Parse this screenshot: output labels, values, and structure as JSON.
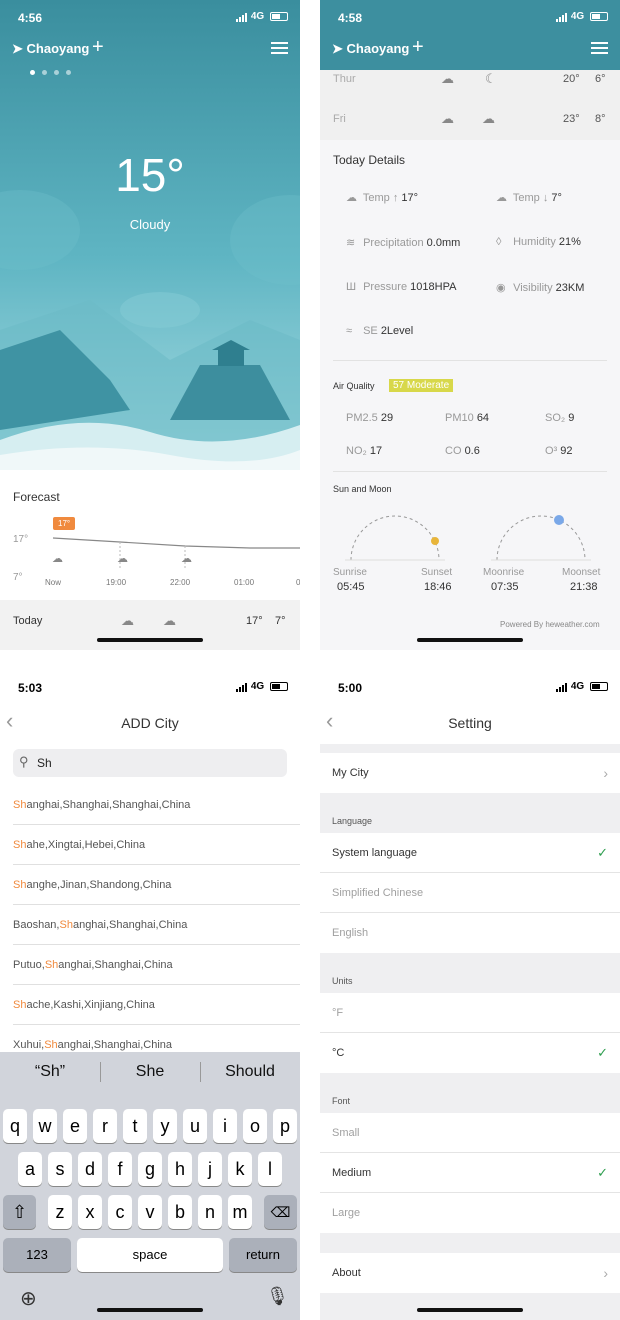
{
  "colors": {
    "teal_top": "#3b8f9f",
    "teal_mid": "#5db3c2",
    "accent_orange": "#f08a3e",
    "aqi_yellow": "#d8d84a",
    "check_green": "#2e9e4f",
    "search_hl": "#f08a3e"
  },
  "p1": {
    "status": {
      "time": "4:56",
      "network": "4G"
    },
    "city": "Chaoyang",
    "plus": "+",
    "temp": "15°",
    "condition": "Cloudy",
    "forecast_title": "Forecast",
    "high_tag": "17°",
    "axis_high": "17°",
    "axis_low": "7°",
    "times": [
      "Now",
      "19:00",
      "22:00",
      "01:00",
      "0"
    ],
    "today_label": "Today",
    "today_high": "17°",
    "today_low": "7°"
  },
  "p2": {
    "status": {
      "time": "4:58",
      "network": "4G"
    },
    "city": "Chaoyang",
    "plus": "+",
    "days": [
      {
        "day": "Thur",
        "hi": "20°",
        "lo": "6°"
      },
      {
        "day": "Fri",
        "hi": "23°",
        "lo": "8°"
      }
    ],
    "details_title": "Today Details",
    "details": {
      "temp_hi_label": "Temp ↑",
      "temp_hi": "17°",
      "temp_lo_label": "Temp ↓",
      "temp_lo": "7°",
      "precip_label": "Precipitation",
      "precip": "0.0mm",
      "humidity_label": "Humidity",
      "humidity": "21%",
      "pressure_label": "Pressure",
      "pressure": "1018HPA",
      "visibility_label": "Visibility",
      "visibility": "23KM",
      "wind_dir": "SE",
      "wind_level": "2Level"
    },
    "aq_label": "Air Quality",
    "aq_badge": "57 Moderate",
    "aq": {
      "pm25_label": "PM2.5",
      "pm25": "29",
      "pm10_label": "PM10",
      "pm10": "64",
      "so2_label": "SO₂",
      "so2": "9",
      "no2_label": "NO₂",
      "no2": "17",
      "co_label": "CO",
      "co": "0.6",
      "o3_label": "O³",
      "o3": "92"
    },
    "sun_title": "Sun and Moon",
    "sunrise_label": "Sunrise",
    "sunrise": "05:45",
    "sunset_label": "Sunset",
    "sunset": "18:46",
    "moonrise_label": "Moonrise",
    "moonrise": "07:35",
    "moonset_label": "Moonset",
    "moonset": "21:38",
    "powered": "Powered By heweather.com"
  },
  "p3": {
    "status": {
      "time": "5:03",
      "network": "4G"
    },
    "title": "ADD City",
    "search_value": "Sh",
    "results": [
      {
        "pre": "",
        "hl": "Sh",
        "post": "anghai,Shanghai,Shanghai,China"
      },
      {
        "pre": "",
        "hl": "Sh",
        "post": "ahe,Xingtai,Hebei,China"
      },
      {
        "pre": "",
        "hl": "Sh",
        "post": "anghe,Jinan,Shandong,China"
      },
      {
        "pre": "Baoshan,",
        "hl": "Sh",
        "post": "anghai,Shanghai,China"
      },
      {
        "pre": "Putuo,",
        "hl": "Sh",
        "post": "anghai,Shanghai,China"
      },
      {
        "pre": "",
        "hl": "Sh",
        "post": "ache,Kashi,Xinjiang,China"
      },
      {
        "pre": "Xuhui,",
        "hl": "Sh",
        "post": "anghai,Shanghai,China"
      }
    ],
    "suggestions": [
      "“Sh”",
      "She",
      "Should"
    ],
    "row1": [
      "q",
      "w",
      "e",
      "r",
      "t",
      "y",
      "u",
      "i",
      "o",
      "p"
    ],
    "row2": [
      "a",
      "s",
      "d",
      "f",
      "g",
      "h",
      "j",
      "k",
      "l"
    ],
    "row3": [
      "z",
      "x",
      "c",
      "v",
      "b",
      "n",
      "m"
    ],
    "key_123": "123",
    "key_space": "space",
    "key_return": "return"
  },
  "p4": {
    "status": {
      "time": "5:00",
      "network": "4G"
    },
    "title": "Setting",
    "my_city": "My City",
    "lang_section": "Language",
    "lang": [
      "System language",
      "Simplified Chinese",
      "English"
    ],
    "units_section": "Units",
    "units": [
      "°F",
      "°C"
    ],
    "font_section": "Font",
    "fonts": [
      "Small",
      "Medium",
      "Large"
    ],
    "about": "About"
  }
}
